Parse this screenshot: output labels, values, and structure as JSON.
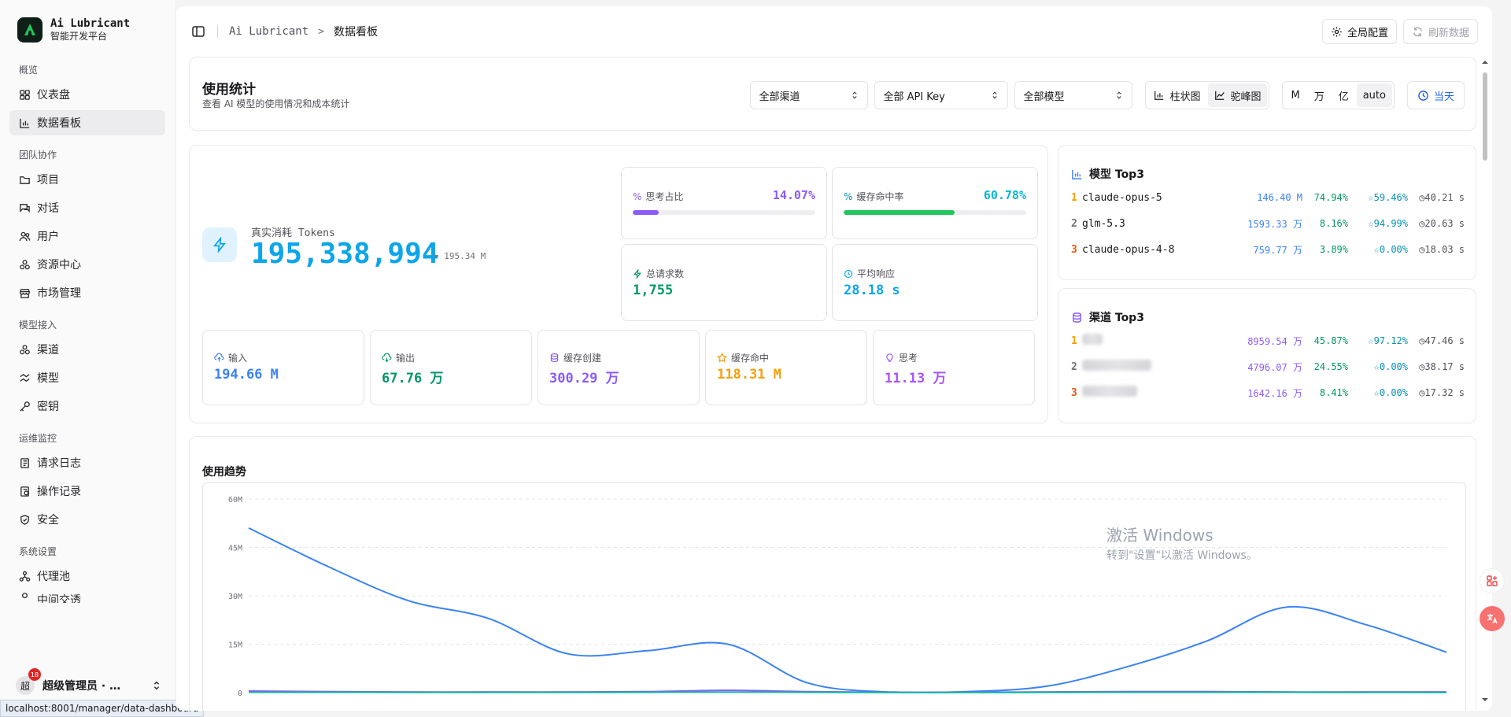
{
  "sidebar": {
    "brand_title": "Ai Lubricant",
    "brand_sub": "智能开发平台",
    "groups": [
      {
        "label": "概览",
        "items": [
          {
            "label": "仪表盘"
          },
          {
            "label": "数据看板"
          }
        ]
      },
      {
        "label": "团队协作",
        "items": [
          {
            "label": "项目"
          },
          {
            "label": "对话"
          },
          {
            "label": "用户"
          },
          {
            "label": "资源中心"
          },
          {
            "label": "市场管理"
          }
        ]
      },
      {
        "label": "模型接入",
        "items": [
          {
            "label": "渠道"
          },
          {
            "label": "模型"
          },
          {
            "label": "密钥"
          }
        ]
      },
      {
        "label": "运维监控",
        "items": [
          {
            "label": "请求日志"
          },
          {
            "label": "操作记录"
          },
          {
            "label": "安全"
          }
        ]
      },
      {
        "label": "系统设置",
        "items": [
          {
            "label": "代理池"
          },
          {
            "label": "中间交透"
          }
        ]
      }
    ],
    "user": {
      "avatar": "超",
      "badge": "18",
      "name": "超级管理员 · …"
    }
  },
  "statusbar": "localhost:8001/manager/data-dashboard",
  "topbar": {
    "crumb_root": "Ai Lubricant",
    "crumb_sep": ">",
    "crumb_current": "数据看板",
    "global_config": "全局配置",
    "refresh": "刷新数据"
  },
  "header": {
    "title": "使用统计",
    "subtitle": "查看 AI 模型的使用情况和成本统计",
    "channel_select": "全部渠道",
    "apikey_select": "全部 API Key",
    "model_select": "全部模型",
    "chart_bar": "柱状图",
    "chart_peak": "驼峰图",
    "units": [
      "M",
      "万",
      "亿",
      "auto"
    ],
    "today": "当天"
  },
  "stats": {
    "real_label": "真实消耗 Tokens",
    "real_value": "195,338,994",
    "real_approx": "≈ 195.34 M",
    "think_ratio_label": "思考占比",
    "think_ratio": "14.07%",
    "think_ratio_fraction": 0.1407,
    "cache_hit_label": "缓存命中率",
    "cache_hit": "60.78%",
    "cache_hit_fraction": 0.6078,
    "total_req_label": "总请求数",
    "total_req": "1,755",
    "avg_resp_label": "平均响应",
    "avg_resp": "28.18 s",
    "input_label": "输入",
    "input": "194.66 M",
    "output_label": "输出",
    "output": "67.76 万",
    "cache_create_label": "缓存创建",
    "cache_create": "300.29 万",
    "cache_hit2_label": "缓存命中",
    "cache_hit2": "118.31 M",
    "think_label": "思考",
    "think": "11.13 万"
  },
  "model_top3": {
    "title": "模型 Top3",
    "rows": [
      {
        "rank": "1",
        "name": "claude-opus-5",
        "value": "146.40 M",
        "pct": "74.94%",
        "hit": "59.46%",
        "time": "40.21 s"
      },
      {
        "rank": "2",
        "name": "glm-5.3",
        "value": "1593.33 万",
        "pct": "8.16%",
        "hit": "94.99%",
        "time": "20.63 s"
      },
      {
        "rank": "3",
        "name": "claude-opus-4-8",
        "value": "759.77 万",
        "pct": "3.89%",
        "hit": "0.00%",
        "time": "18.03 s"
      }
    ]
  },
  "channel_top3": {
    "title": "渠道 Top3",
    "rows": [
      {
        "rank": "1",
        "value": "8959.54 万",
        "pct": "45.87%",
        "hit": "97.12%",
        "time": "47.46 s"
      },
      {
        "rank": "2",
        "value": "4796.07 万",
        "pct": "24.55%",
        "hit": "0.00%",
        "time": "38.17 s"
      },
      {
        "rank": "3",
        "value": "1642.16 万",
        "pct": "8.41%",
        "hit": "0.00%",
        "time": "17.32 s"
      }
    ]
  },
  "trend": {
    "title": "使用趋势"
  },
  "chart_data": {
    "type": "line",
    "ylim": [
      0,
      60000000
    ],
    "yticks": [
      "0",
      "15M",
      "30M",
      "45M",
      "60M"
    ],
    "series": [
      {
        "color": "#3b82f6",
        "values": [
          51000000,
          39000000,
          28500000,
          23000000,
          12000000,
          13000000,
          15000000,
          3000000,
          200000,
          300000,
          2000000,
          8000000,
          16000000,
          26500000,
          21000000,
          12500000
        ]
      },
      {
        "color": "#8b5cf6",
        "values": [
          500000,
          300000,
          200000,
          200000,
          200000,
          300000,
          700000,
          300000,
          100000,
          100000,
          200000,
          300000,
          300000,
          200000,
          200000,
          200000
        ]
      },
      {
        "color": "#14b8a6",
        "values": [
          100000,
          100000,
          50000,
          50000,
          50000,
          80000,
          150000,
          80000,
          20000,
          20000,
          50000,
          100000,
          100000,
          80000,
          60000,
          40000
        ]
      }
    ]
  },
  "watermark": {
    "line1": "激活 Windows",
    "line2": "转到\"设置\"以激活 Windows。"
  },
  "colors": {
    "think": "#8b5cf6",
    "cache": "#22c55e",
    "primary": "#0ea5e9",
    "blue": "#3b82f6",
    "green": "#059669",
    "purple": "#8b5cf6",
    "amber": "#f59e0b",
    "violet": "#a855f7"
  }
}
